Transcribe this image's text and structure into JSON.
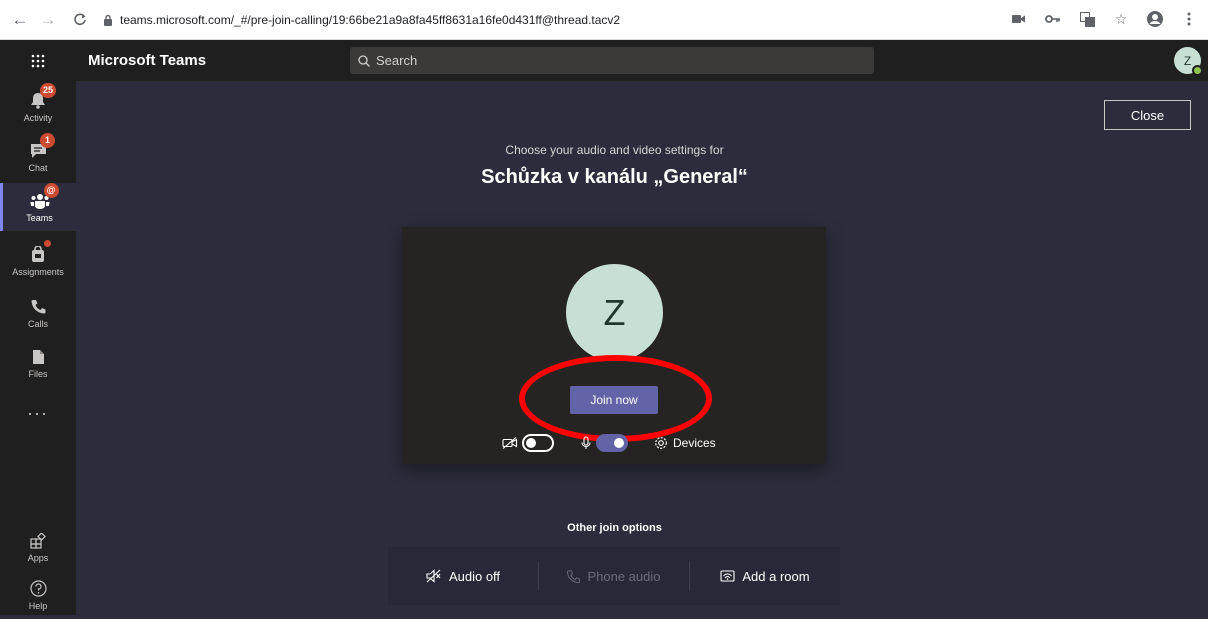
{
  "browser": {
    "url_host": "teams.microsoft.com",
    "url_path": "/_#/pre-join-calling/19:66be21a9a8fa45ff8631a16fe0d431ff@thread.tacv2"
  },
  "header": {
    "app_title": "Microsoft Teams",
    "search_placeholder": "Search",
    "avatar_initial": "Z"
  },
  "rail": {
    "items": [
      {
        "label": "Activity",
        "badge": "25"
      },
      {
        "label": "Chat",
        "badge": "1"
      },
      {
        "label": "Teams",
        "badge": "@"
      },
      {
        "label": "Assignments"
      },
      {
        "label": "Calls"
      },
      {
        "label": "Files"
      },
      {
        "label": "Apps"
      },
      {
        "label": "Help"
      }
    ],
    "more": "..."
  },
  "main": {
    "close_label": "Close",
    "subtitle": "Choose your audio and video settings for",
    "meeting_title": "Schůzka v kanálu „General“",
    "avatar_initial": "Z",
    "join_label": "Join now",
    "devices_label": "Devices",
    "camera_on": false,
    "mic_on": true,
    "other_title": "Other join options",
    "options": [
      {
        "label": "Audio off"
      },
      {
        "label": "Phone audio"
      },
      {
        "label": "Add a room"
      }
    ]
  },
  "colors": {
    "accent": "#6264a7",
    "annotation": "#ff0000",
    "badge": "#cc4a31"
  }
}
